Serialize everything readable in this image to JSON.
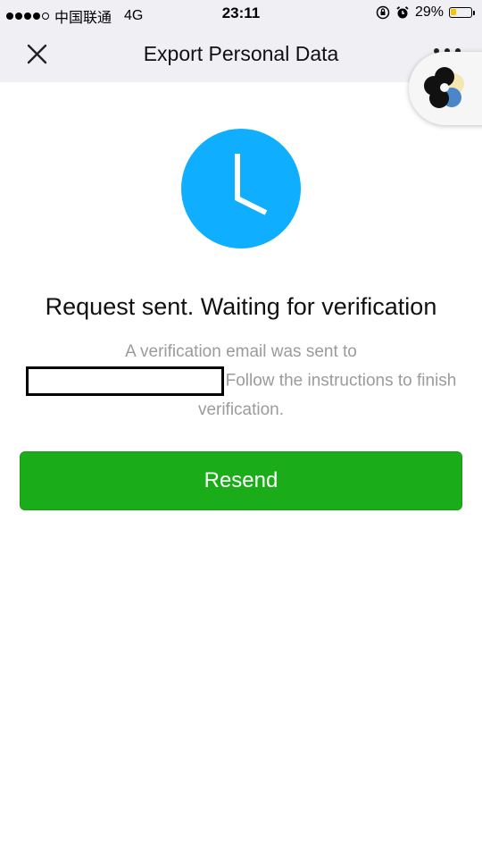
{
  "status_bar": {
    "carrier": "中国联通",
    "network": "4G",
    "time": "23:11",
    "battery_percent": "29%",
    "battery_level": 0.29,
    "icons": [
      "signal-dots-icon",
      "rotation-lock-icon",
      "alarm-icon",
      "battery-icon"
    ]
  },
  "nav": {
    "title": "Export Personal Data",
    "close_icon": "close-icon",
    "more_icon": "more-icon"
  },
  "main": {
    "status_icon": "clock-icon",
    "headline": "Request sent. Waiting for verification",
    "desc_prefix": "A verification email was sent to",
    "email_value": "",
    "desc_suffix": "Follow the instructions to finish verification.",
    "resend_label": "Resend"
  },
  "colors": {
    "accent_green": "#1aad19",
    "clock_blue": "#10aeff",
    "nav_bg": "#efeff4",
    "secondary_text": "#9b9b9b"
  }
}
